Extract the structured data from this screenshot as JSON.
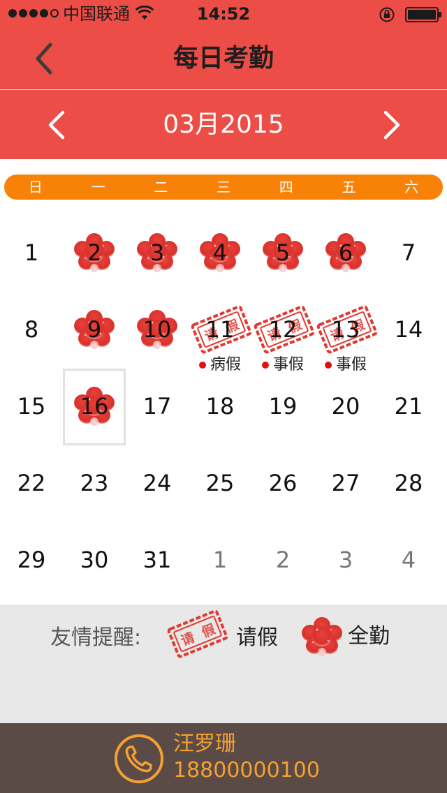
{
  "status_bar": {
    "carrier": "中国联通",
    "time": "14:52",
    "signal_bars_filled": 4,
    "signal_bars_total": 5,
    "battery_level": 1.0
  },
  "nav": {
    "title": "每日考勤",
    "back_icon": "chevron-left-icon"
  },
  "month": {
    "label": "03月2015",
    "prev_icon": "chevron-left-icon",
    "next_icon": "chevron-right-icon"
  },
  "weekdays": [
    "日",
    "一",
    "二",
    "三",
    "四",
    "五",
    "六"
  ],
  "days": [
    {
      "num": "1",
      "mark": "",
      "note": ""
    },
    {
      "num": "2",
      "mark": "full",
      "note": ""
    },
    {
      "num": "3",
      "mark": "full",
      "note": ""
    },
    {
      "num": "4",
      "mark": "full",
      "note": ""
    },
    {
      "num": "5",
      "mark": "full",
      "note": ""
    },
    {
      "num": "6",
      "mark": "full",
      "note": ""
    },
    {
      "num": "7",
      "mark": "",
      "note": ""
    },
    {
      "num": "8",
      "mark": "",
      "note": ""
    },
    {
      "num": "9",
      "mark": "full",
      "note": ""
    },
    {
      "num": "10",
      "mark": "full",
      "note": ""
    },
    {
      "num": "11",
      "mark": "leave",
      "note": "病假"
    },
    {
      "num": "12",
      "mark": "leave",
      "note": "事假"
    },
    {
      "num": "13",
      "mark": "leave",
      "note": "事假"
    },
    {
      "num": "14",
      "mark": "",
      "note": ""
    },
    {
      "num": "15",
      "mark": "",
      "note": ""
    },
    {
      "num": "16",
      "mark": "full",
      "note": "",
      "today": true
    },
    {
      "num": "17",
      "mark": "",
      "note": ""
    },
    {
      "num": "18",
      "mark": "",
      "note": ""
    },
    {
      "num": "19",
      "mark": "",
      "note": ""
    },
    {
      "num": "20",
      "mark": "",
      "note": ""
    },
    {
      "num": "21",
      "mark": "",
      "note": ""
    },
    {
      "num": "22",
      "mark": "",
      "note": ""
    },
    {
      "num": "23",
      "mark": "",
      "note": ""
    },
    {
      "num": "24",
      "mark": "",
      "note": ""
    },
    {
      "num": "25",
      "mark": "",
      "note": ""
    },
    {
      "num": "26",
      "mark": "",
      "note": ""
    },
    {
      "num": "27",
      "mark": "",
      "note": ""
    },
    {
      "num": "28",
      "mark": "",
      "note": ""
    },
    {
      "num": "29",
      "mark": "",
      "note": ""
    },
    {
      "num": "30",
      "mark": "",
      "note": ""
    },
    {
      "num": "31",
      "mark": "",
      "note": ""
    },
    {
      "num": "1",
      "mark": "",
      "note": "",
      "other_month": true
    },
    {
      "num": "2",
      "mark": "",
      "note": "",
      "other_month": true
    },
    {
      "num": "3",
      "mark": "",
      "note": "",
      "other_month": true
    },
    {
      "num": "4",
      "mark": "",
      "note": "",
      "other_month": true
    }
  ],
  "legend": {
    "title": "友情提醒:",
    "leave_label": "请假",
    "full_label": "全勤",
    "stamp_text": "请假"
  },
  "footer": {
    "name": "汪罗珊",
    "phone": "18800000100"
  },
  "colors": {
    "header_red": "#ec4d47",
    "weekday_orange": "#f78207",
    "stamp_red": "#e03a32",
    "footer_brown": "#5b4b46",
    "footer_accent": "#f5a032",
    "legend_bg": "#e8e8e8"
  }
}
